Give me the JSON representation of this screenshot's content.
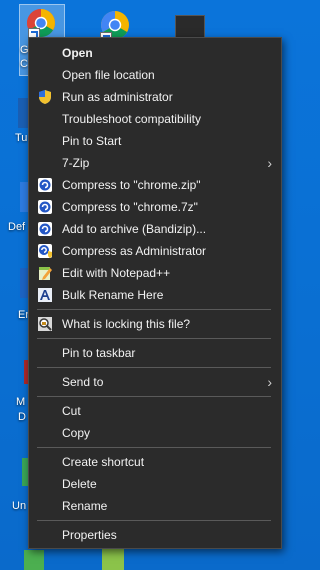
{
  "desktop": {
    "icons": [
      {
        "label": "G",
        "label2": "C"
      },
      {
        "label": "Tu"
      },
      {
        "label": "Def"
      },
      {
        "label": "En"
      },
      {
        "label": "M",
        "label2": "D"
      },
      {
        "label": "Un"
      }
    ]
  },
  "menu": {
    "groups": [
      [
        {
          "label": "Open",
          "icon": "none",
          "bold": true
        },
        {
          "label": "Open file location",
          "icon": "none"
        },
        {
          "label": "Run as administrator",
          "icon": "uac-shield-icon"
        },
        {
          "label": "Troubleshoot compatibility",
          "icon": "none"
        },
        {
          "label": "Pin to Start",
          "icon": "none"
        },
        {
          "label": "7-Zip",
          "icon": "none",
          "submenu": true
        },
        {
          "label": "Compress to \"chrome.zip\"",
          "icon": "bandizip-icon"
        },
        {
          "label": "Compress to \"chrome.7z\"",
          "icon": "bandizip-icon"
        },
        {
          "label": "Add to archive (Bandizip)...",
          "icon": "bandizip-icon"
        },
        {
          "label": "Compress as Administrator",
          "icon": "bandizip-admin-icon"
        },
        {
          "label": "Edit with Notepad++",
          "icon": "notepad-plus-plus-icon"
        },
        {
          "label": "Bulk Rename Here",
          "icon": "bulk-rename-icon"
        }
      ],
      [
        {
          "label": "What is locking this file?",
          "icon": "magnifier-lock-icon"
        }
      ],
      [
        {
          "label": "Pin to taskbar",
          "icon": "none"
        }
      ],
      [
        {
          "label": "Send to",
          "icon": "none",
          "submenu": true
        }
      ],
      [
        {
          "label": "Cut",
          "icon": "none"
        },
        {
          "label": "Copy",
          "icon": "none"
        }
      ],
      [
        {
          "label": "Create shortcut",
          "icon": "none"
        },
        {
          "label": "Delete",
          "icon": "none"
        },
        {
          "label": "Rename",
          "icon": "none"
        }
      ],
      [
        {
          "label": "Properties",
          "icon": "none"
        }
      ]
    ]
  }
}
